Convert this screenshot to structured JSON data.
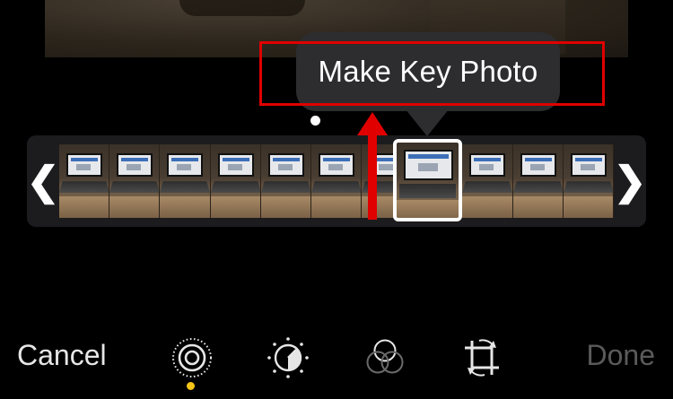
{
  "tooltip": {
    "text": "Make Key Photo"
  },
  "toolbar": {
    "cancel_label": "Cancel",
    "done_label": "Done",
    "tools": [
      {
        "name": "live-photo",
        "icon": "live-photo-icon",
        "active": true
      },
      {
        "name": "adjust",
        "icon": "adjust-dial-icon",
        "active": false
      },
      {
        "name": "filters",
        "icon": "filters-icon",
        "active": false
      },
      {
        "name": "crop",
        "icon": "crop-rotate-icon",
        "active": false
      }
    ]
  },
  "colors": {
    "background": "#000000",
    "tooltip": "#2d2d2f",
    "highlight": "#e00000",
    "active_indicator": "#f5c518",
    "done_disabled": "#5a5a5a"
  },
  "filmstrip": {
    "frame_count": 11,
    "selected_frame": 7
  }
}
